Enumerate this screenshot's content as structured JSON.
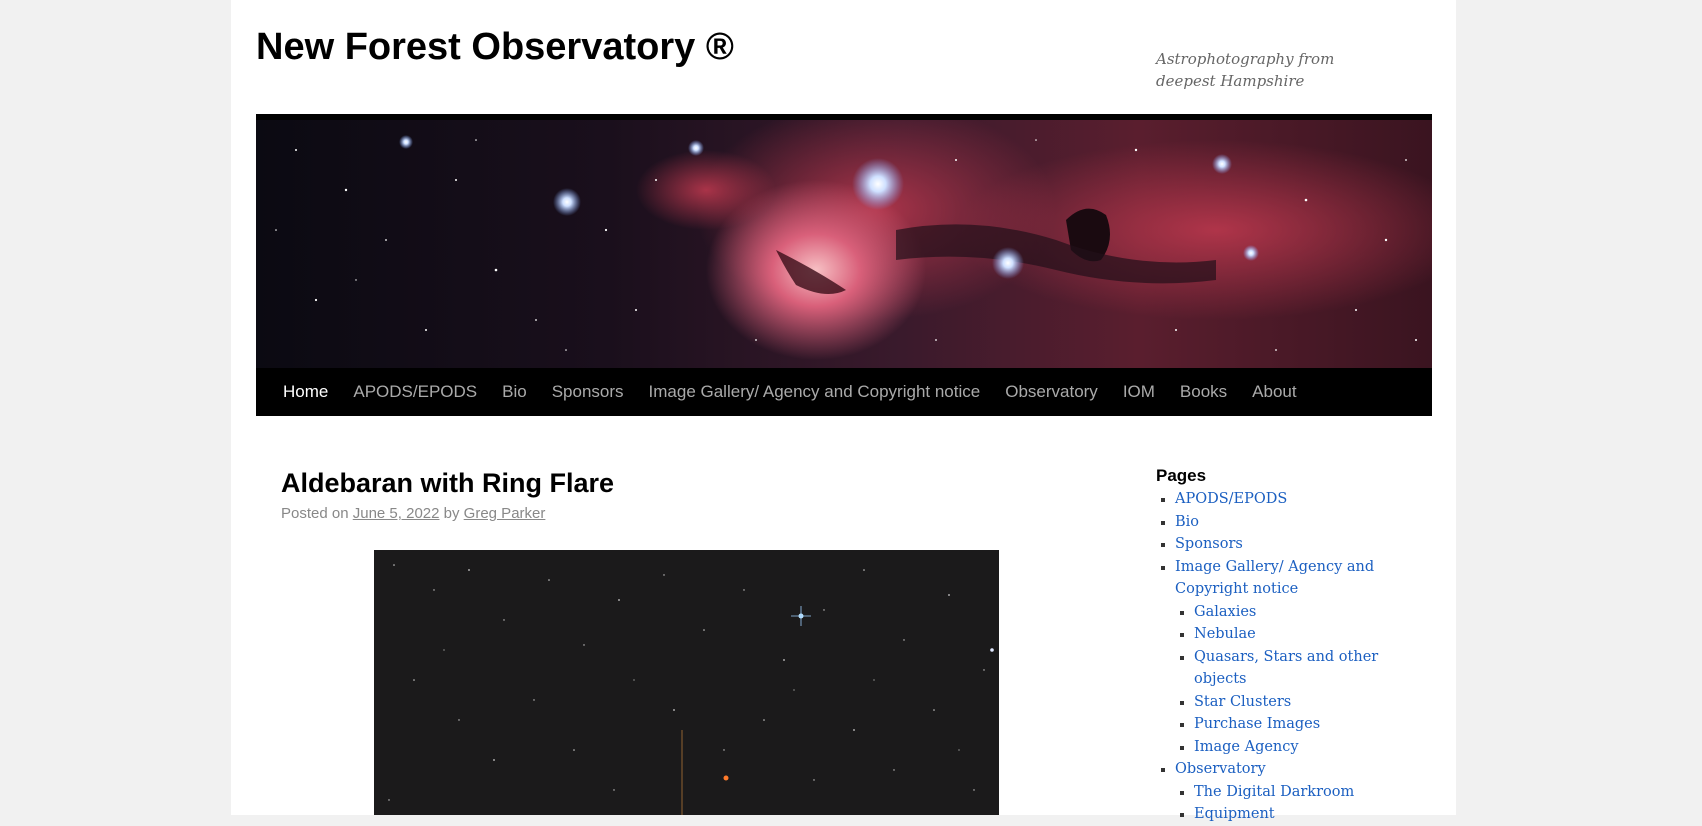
{
  "site": {
    "title": "New Forest Observatory ®",
    "description": "Astrophotography from deepest Hampshire"
  },
  "nav": {
    "items": [
      {
        "label": "Home",
        "current": true
      },
      {
        "label": "APODS/EPODS"
      },
      {
        "label": "Bio"
      },
      {
        "label": "Sponsors"
      },
      {
        "label": "Image Gallery/ Agency and Copyright notice"
      },
      {
        "label": "Observatory"
      },
      {
        "label": "IOM"
      },
      {
        "label": "Books"
      },
      {
        "label": "About"
      }
    ]
  },
  "post": {
    "title": "Aldebaran with Ring Flare",
    "posted_on": "Posted on",
    "date": "June 5, 2022",
    "by": "by",
    "author": "Greg Parker"
  },
  "sidebar": {
    "heading": "Pages",
    "items": [
      {
        "label": "APODS/EPODS"
      },
      {
        "label": "Bio"
      },
      {
        "label": "Sponsors"
      },
      {
        "label": "Image Gallery/ Agency and Copyright notice",
        "children": [
          {
            "label": "Galaxies"
          },
          {
            "label": "Nebulae"
          },
          {
            "label": "Quasars, Stars and other objects"
          },
          {
            "label": "Star Clusters"
          },
          {
            "label": "Purchase Images"
          },
          {
            "label": "Image Agency"
          }
        ]
      },
      {
        "label": "Observatory",
        "children": [
          {
            "label": "The Digital Darkroom"
          },
          {
            "label": "Equipment"
          }
        ]
      }
    ]
  },
  "colors": {
    "link": "#1b5fc1",
    "nav_background": "#000000",
    "page_background": "#f1f1f1"
  }
}
